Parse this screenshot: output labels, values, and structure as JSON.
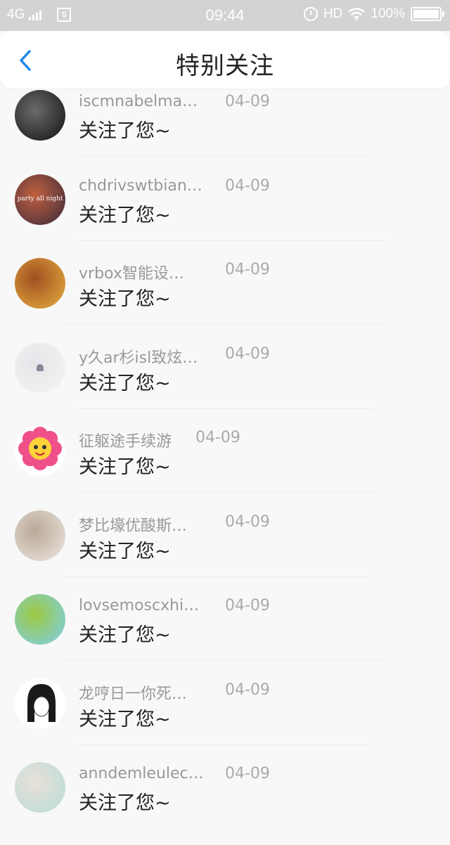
{
  "status_bar": {
    "network": "4G",
    "time": "09:44",
    "hd": "HD",
    "battery": "100%"
  },
  "header": {
    "title": "特别关注",
    "back_icon": "chevron-left-icon"
  },
  "colors": {
    "accent": "#1e88e5",
    "status_bar_bg": "#d3d3d3",
    "name_text": "#999999",
    "message_text": "#222222"
  },
  "items": [
    {
      "name": "iscmnabelma…",
      "date": "04-09",
      "message": "关注了您~",
      "avatar_colors": [
        "#111111",
        "#6b6b6b"
      ],
      "avatar_text": ""
    },
    {
      "name": "chdrivswtbian…",
      "date": "04-09",
      "message": "关注了您~",
      "avatar_colors": [
        "#3a2a3a",
        "#c06040"
      ],
      "avatar_text": "party all night"
    },
    {
      "name": "vrbox智能设…",
      "date": "04-09",
      "message": "关注了您~",
      "avatar_colors": [
        "#e8b040",
        "#a05020"
      ],
      "avatar_text": ""
    },
    {
      "name": "y久ar杉isl致炫…",
      "date": "04-09",
      "message": "关注了您~",
      "avatar_colors": [
        "#f4f4f4",
        "#e6e6ea"
      ],
      "avatar_text": ""
    },
    {
      "name": "征躯途手续游",
      "date": "04-09",
      "message": "关注了您~",
      "avatar_colors": [
        "#ffffff",
        "#ffffff"
      ],
      "avatar_text": ""
    },
    {
      "name": "梦比壕优酸斯…",
      "date": "04-09",
      "message": "关注了您~",
      "avatar_colors": [
        "#efe8e0",
        "#b8a898"
      ],
      "avatar_text": ""
    },
    {
      "name": "lovsemoscxhi…",
      "date": "04-09",
      "message": "关注了您~",
      "avatar_colors": [
        "#7ed0f0",
        "#9cc840"
      ],
      "avatar_text": ""
    },
    {
      "name": "龙哼日一你死…",
      "date": "04-09",
      "message": "关注了您~",
      "avatar_colors": [
        "#ffffff",
        "#ffffff"
      ],
      "avatar_text": ""
    },
    {
      "name": "anndemleulec…",
      "date": "04-09",
      "message": "关注了您~",
      "avatar_colors": [
        "#b8ddd8",
        "#e8e0d8"
      ],
      "avatar_text": ""
    }
  ]
}
